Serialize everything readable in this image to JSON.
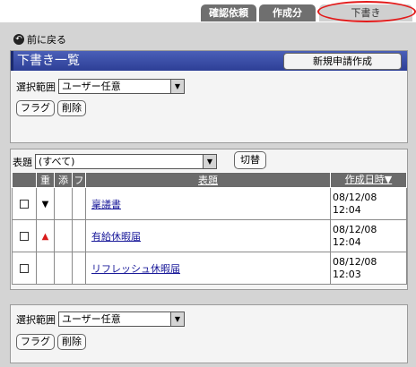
{
  "tabs": [
    {
      "label": "確認依頼"
    },
    {
      "label": "作成分"
    },
    {
      "label": "下書き",
      "active": true
    }
  ],
  "back_label": "前に戻る",
  "page_title": "下書き一覧",
  "new_request_label": "新規申請作成",
  "scope": {
    "label": "選択範囲",
    "value": "ユーザー任意"
  },
  "buttons": {
    "flag": "フラグ",
    "delete": "削除"
  },
  "filter": {
    "label": "表題",
    "value": "(すべて)",
    "switch_label": "切替"
  },
  "table": {
    "headers": {
      "pri": "重",
      "att": "添",
      "flag": "フ",
      "title": "表題",
      "created": "作成日時▼"
    },
    "rows": [
      {
        "priority": "down",
        "title": "稟議書",
        "date": "08/12/08",
        "time": "12:04"
      },
      {
        "priority": "up",
        "title": "有給休暇届",
        "date": "08/12/08",
        "time": "12:04"
      },
      {
        "priority": "",
        "title": "リフレッシュ休暇届",
        "date": "08/12/08",
        "time": "12:03"
      }
    ]
  },
  "bottom_scope": {
    "label": "選択範囲",
    "value": "ユーザー任意"
  },
  "colors": {
    "title_bar": "#2d3f96",
    "header_bg": "#6b6b6b",
    "highlight_ring": "#e21b1b",
    "priority_high": "#d91c1c"
  }
}
